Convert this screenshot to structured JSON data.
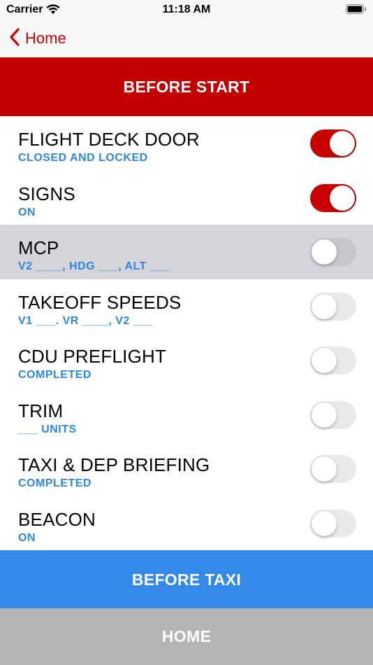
{
  "status": {
    "carrier": "Carrier",
    "time": "11:18 AM"
  },
  "nav": {
    "back_label": "Home"
  },
  "header": {
    "title": "BEFORE START"
  },
  "items": [
    {
      "title": "FLIGHT DECK DOOR",
      "subtitle": "CLOSED AND LOCKED",
      "on": true
    },
    {
      "title": "SIGNS",
      "subtitle": "ON",
      "on": true
    },
    {
      "title": "MCP",
      "subtitle": "V2 ____, HDG ___, ALT ___",
      "on": false,
      "selected": true
    },
    {
      "title": "TAKEOFF SPEEDS",
      "subtitle": "V1 ___. VR ____, V2 ___",
      "on": false
    },
    {
      "title": "CDU PREFLIGHT",
      "subtitle": "COMPLETED",
      "on": false
    },
    {
      "title": "TRIM",
      "subtitle": "___ UNITS",
      "on": false
    },
    {
      "title": "TAXI & DEP BRIEFING",
      "subtitle": "COMPLETED",
      "on": false
    },
    {
      "title": "BEACON",
      "subtitle": "ON",
      "on": false
    }
  ],
  "footer": {
    "next_label": "BEFORE TAXI",
    "home_label": "HOME"
  },
  "colors": {
    "accent_red": "#c20000",
    "accent_blue": "#3389e5",
    "subtitle_blue": "#2c87e3"
  }
}
